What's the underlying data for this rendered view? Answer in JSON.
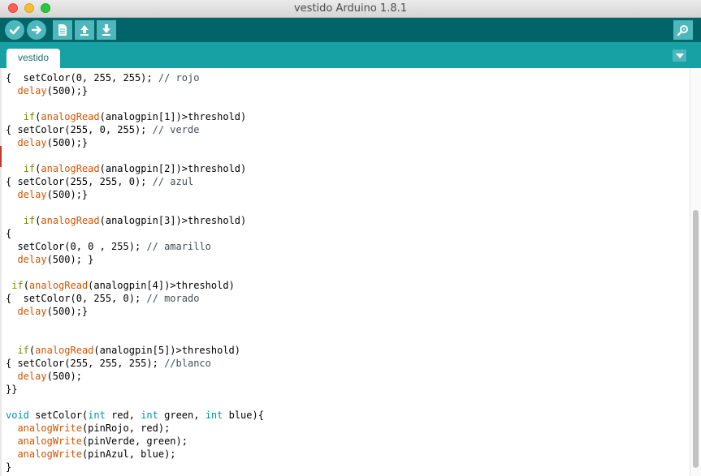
{
  "window": {
    "title": "vestido Arduino 1.8.1"
  },
  "toolbar": {
    "verify_icon": "check-icon",
    "upload_icon": "right-arrow-icon",
    "new_icon": "new-file-icon",
    "open_icon": "up-arrow-icon",
    "save_icon": "down-arrow-icon",
    "serial_monitor_icon": "magnifier-icon"
  },
  "tabs": [
    {
      "label": "vestido"
    }
  ],
  "colors": {
    "toolbar": "#006468",
    "tabbar": "#17a1a5",
    "button": "#4db7bb",
    "function": "#d35400",
    "keyword": "#728e00",
    "type": "#00979c",
    "comment": "#434f54"
  },
  "code": {
    "lines": [
      [
        {
          "t": "{  setColor(0, 255, 255); "
        },
        {
          "t": "// rojo",
          "c": "cm"
        }
      ],
      [
        {
          "t": "  "
        },
        {
          "t": "delay",
          "c": "fn"
        },
        {
          "t": "(500);}"
        }
      ],
      [
        {
          "t": ""
        }
      ],
      [
        {
          "t": "   "
        },
        {
          "t": "if",
          "c": "kw"
        },
        {
          "t": "("
        },
        {
          "t": "analogRead",
          "c": "fn"
        },
        {
          "t": "(analogpin[1])>threshold)"
        }
      ],
      [
        {
          "t": "{ setColor(255, 0, 255); "
        },
        {
          "t": "// verde",
          "c": "cm"
        }
      ],
      [
        {
          "t": "  "
        },
        {
          "t": "delay",
          "c": "fn"
        },
        {
          "t": "(500);}"
        }
      ],
      [
        {
          "t": ""
        }
      ],
      [
        {
          "t": "   "
        },
        {
          "t": "if",
          "c": "kw"
        },
        {
          "t": "("
        },
        {
          "t": "analogRead",
          "c": "fn"
        },
        {
          "t": "(analogpin[2])>threshold)"
        }
      ],
      [
        {
          "t": "{ setColor(255, 255, 0); "
        },
        {
          "t": "// azul",
          "c": "cm"
        }
      ],
      [
        {
          "t": "  "
        },
        {
          "t": "delay",
          "c": "fn"
        },
        {
          "t": "(500);}"
        }
      ],
      [
        {
          "t": ""
        }
      ],
      [
        {
          "t": "   "
        },
        {
          "t": "if",
          "c": "kw"
        },
        {
          "t": "("
        },
        {
          "t": "analogRead",
          "c": "fn"
        },
        {
          "t": "(analogpin[3])>threshold)"
        }
      ],
      [
        {
          "t": "{"
        }
      ],
      [
        {
          "t": "  setColor(0, 0 , 255); "
        },
        {
          "t": "// amarillo",
          "c": "cm"
        }
      ],
      [
        {
          "t": "  "
        },
        {
          "t": "delay",
          "c": "fn"
        },
        {
          "t": "(500); }"
        }
      ],
      [
        {
          "t": ""
        }
      ],
      [
        {
          "t": " "
        },
        {
          "t": "if",
          "c": "kw"
        },
        {
          "t": "("
        },
        {
          "t": "analogRead",
          "c": "fn"
        },
        {
          "t": "(analogpin[4])>threshold)"
        }
      ],
      [
        {
          "t": "{  setColor(0, 255, 0); "
        },
        {
          "t": "// morado",
          "c": "cm"
        }
      ],
      [
        {
          "t": "  "
        },
        {
          "t": "delay",
          "c": "fn"
        },
        {
          "t": "(500);}"
        }
      ],
      [
        {
          "t": ""
        }
      ],
      [
        {
          "t": ""
        }
      ],
      [
        {
          "t": "  "
        },
        {
          "t": "if",
          "c": "kw"
        },
        {
          "t": "("
        },
        {
          "t": "analogRead",
          "c": "fn"
        },
        {
          "t": "(analogpin[5])>threshold)"
        }
      ],
      [
        {
          "t": "{ setColor(255, 255, 255); "
        },
        {
          "t": "//blanco",
          "c": "cm"
        }
      ],
      [
        {
          "t": "  "
        },
        {
          "t": "delay",
          "c": "fn"
        },
        {
          "t": "(500);"
        }
      ],
      [
        {
          "t": "}}"
        }
      ],
      [
        {
          "t": ""
        }
      ],
      [
        {
          "t": "void",
          "c": "ty"
        },
        {
          "t": " setColor("
        },
        {
          "t": "int",
          "c": "ty"
        },
        {
          "t": " red, "
        },
        {
          "t": "int",
          "c": "ty"
        },
        {
          "t": " green, "
        },
        {
          "t": "int",
          "c": "ty"
        },
        {
          "t": " blue){"
        }
      ],
      [
        {
          "t": "  "
        },
        {
          "t": "analogWrite",
          "c": "fn"
        },
        {
          "t": "(pinRojo, red);"
        }
      ],
      [
        {
          "t": "  "
        },
        {
          "t": "analogWrite",
          "c": "fn"
        },
        {
          "t": "(pinVerde, green);"
        }
      ],
      [
        {
          "t": "  "
        },
        {
          "t": "analogWrite",
          "c": "fn"
        },
        {
          "t": "(pinAzul, blue);"
        }
      ],
      [
        {
          "t": "}"
        }
      ]
    ]
  }
}
